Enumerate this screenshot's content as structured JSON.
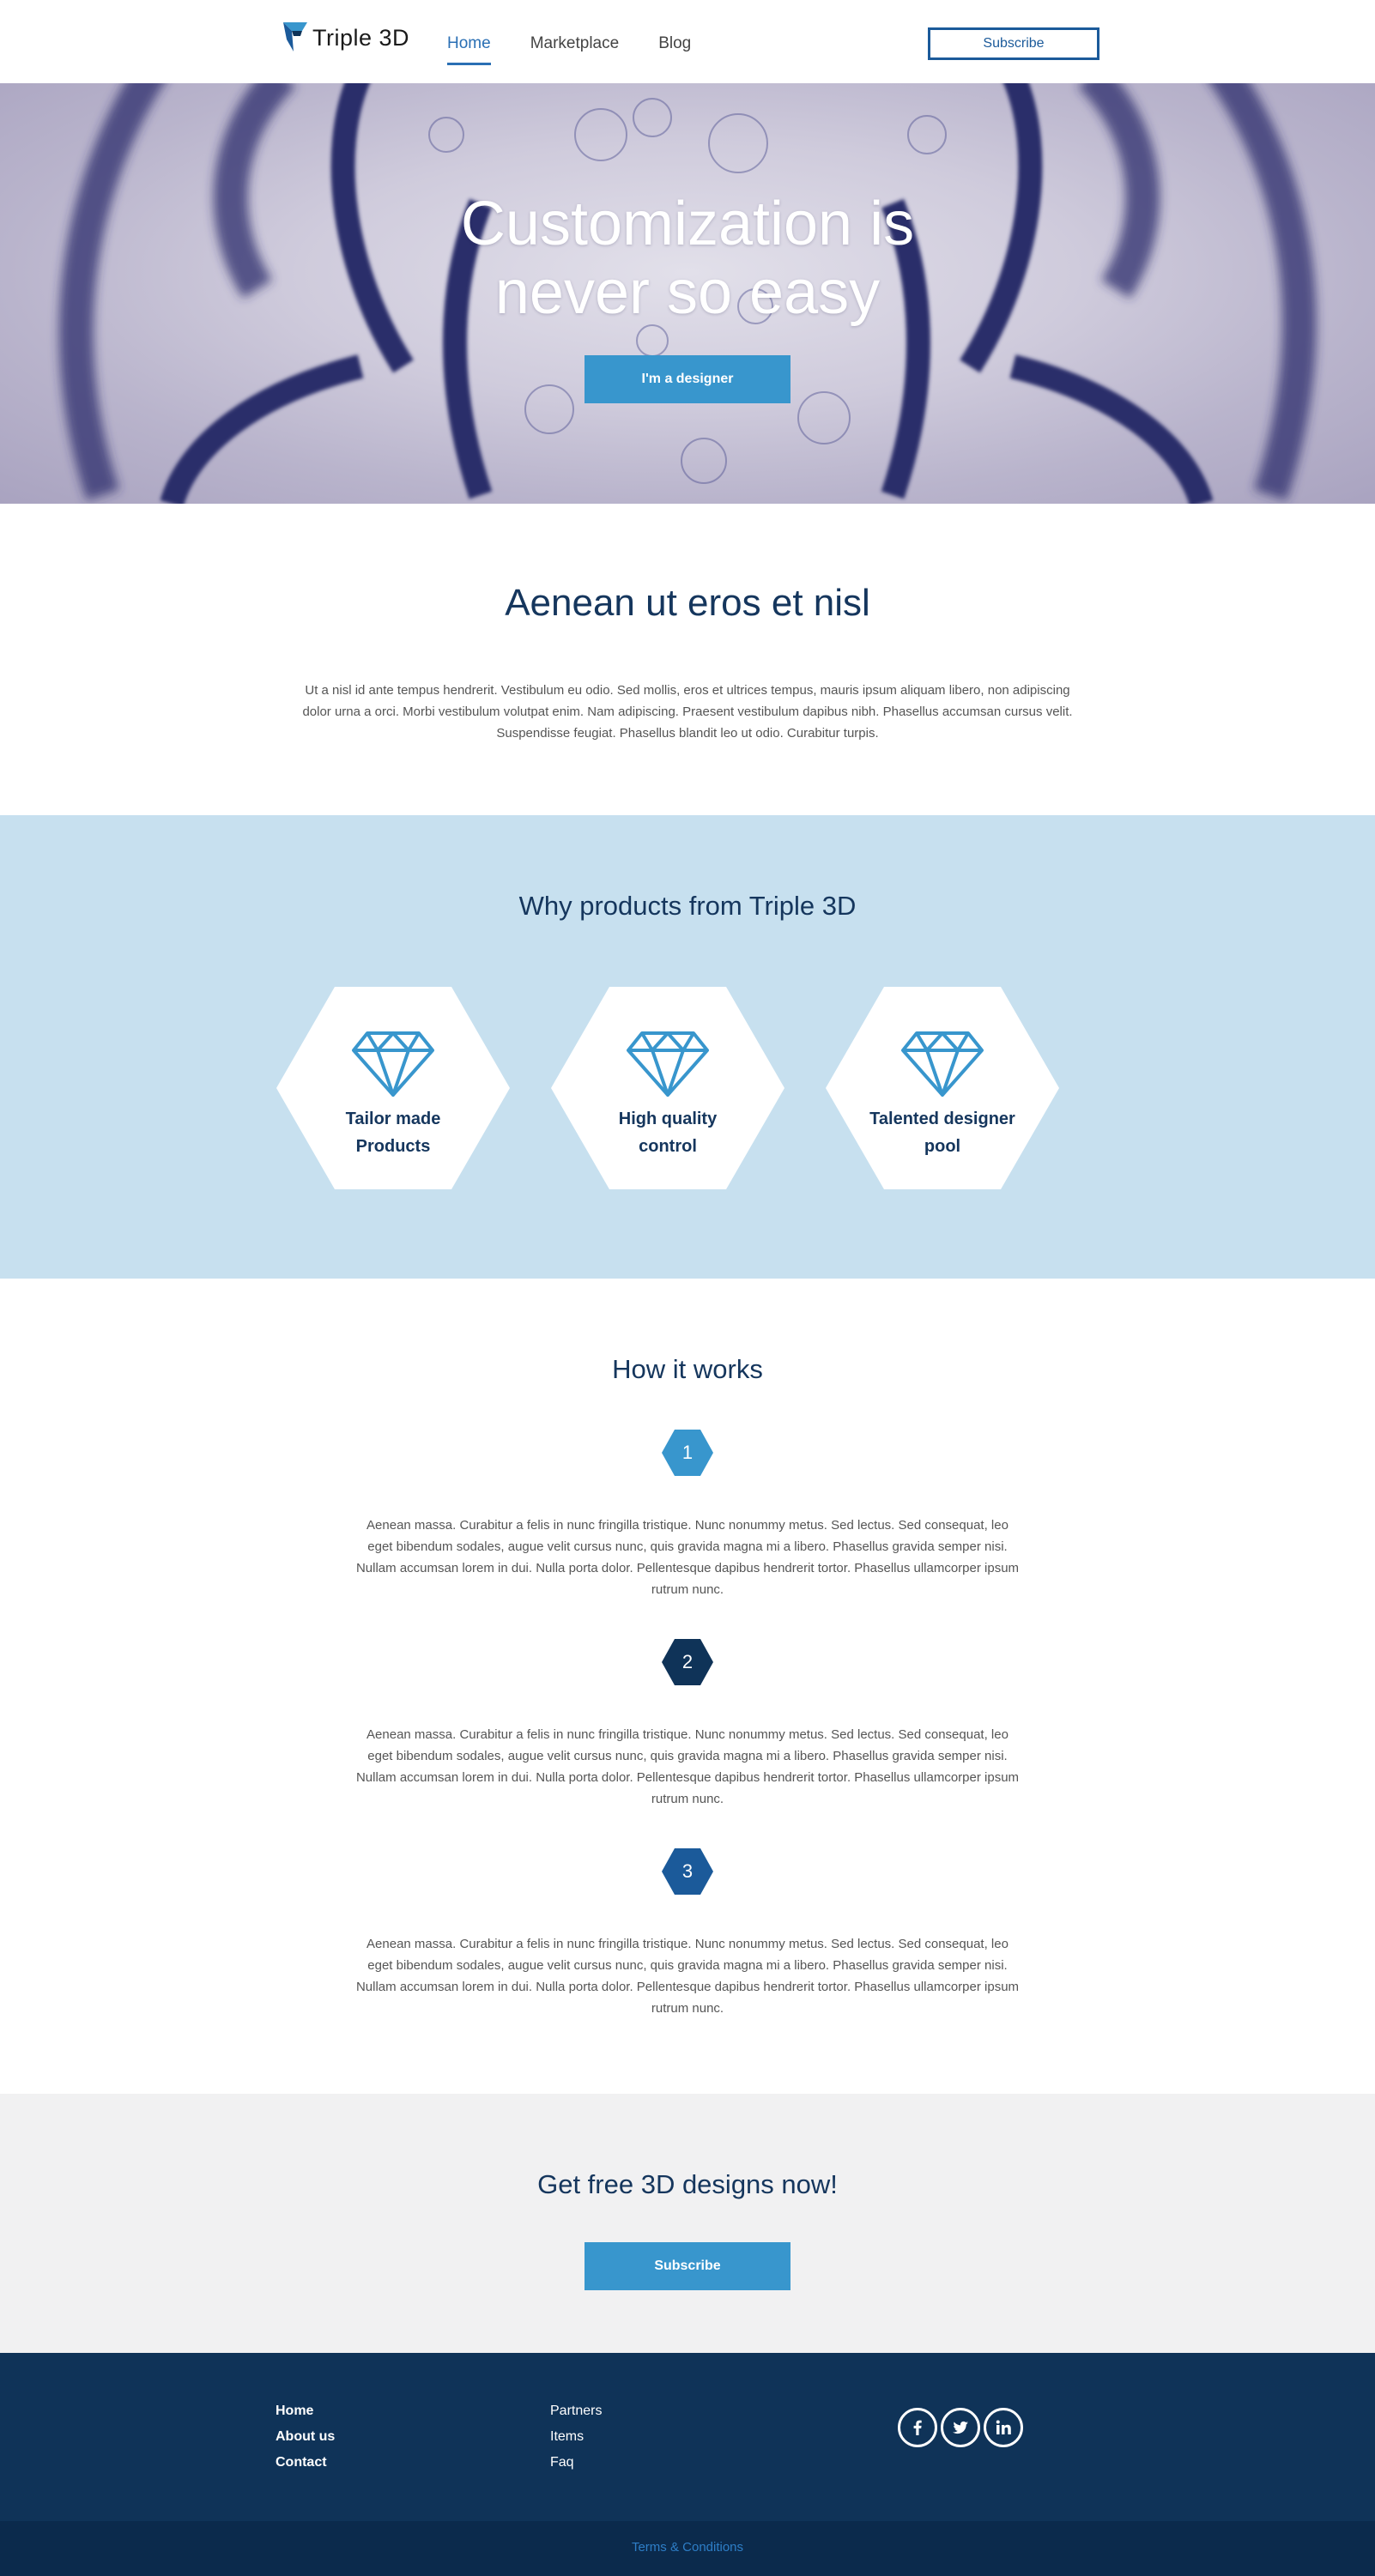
{
  "header": {
    "logo_text": "Triple 3D",
    "nav": [
      "Home",
      "Marketplace",
      "Blog"
    ],
    "active_nav": "Home",
    "subscribe_label": "Subscribe"
  },
  "hero": {
    "title_line1": "Customization is",
    "title_line2": "never so easy",
    "button_label": "I'm a designer"
  },
  "intro": {
    "title": "Aenean ut eros et nisl",
    "text": "Ut a nisl id ante tempus hendrerit. Vestibulum eu odio. Sed mollis, eros et ultrices tempus, mauris ipsum aliquam libero, non adipiscing dolor urna a orci. Morbi vestibulum volutpat enim. Nam adipiscing. Praesent vestibulum dapibus nibh. Phasellus accumsan cursus velit. Suspendisse feugiat. Phasellus blandit leo ut odio. Curabitur turpis."
  },
  "why": {
    "title": "Why products from Triple 3D",
    "cards": [
      {
        "line1": "Tailor made",
        "line2": "Products",
        "icon": "diamond-icon"
      },
      {
        "line1": "High quality",
        "line2": "control",
        "icon": "diamond-icon"
      },
      {
        "line1": "Talented designer",
        "line2": "pool",
        "icon": "diamond-icon"
      }
    ]
  },
  "how": {
    "title": "How it works",
    "steps": [
      {
        "number": "1",
        "color": "#3896cd",
        "text": "Aenean massa. Curabitur a felis in nunc fringilla tristique. Nunc nonummy metus. Sed lectus. Sed consequat, leo eget bibendum sodales, augue velit cursus nunc, quis gravida magna mi a libero. Phasellus gravida semper nisi. Nullam accumsan lorem in dui. Nulla porta dolor. Pellentesque dapibus hendrerit tortor. Phasellus ullamcorper ipsum rutrum nunc."
      },
      {
        "number": "2",
        "color": "#0f3358",
        "text": "Aenean massa. Curabitur a felis in nunc fringilla tristique. Nunc nonummy metus. Sed lectus. Sed consequat, leo eget bibendum sodales, augue velit cursus nunc, quis gravida magna mi a libero. Phasellus gravida semper nisi. Nullam accumsan lorem in dui. Nulla porta dolor. Pellentesque dapibus hendrerit tortor. Phasellus ullamcorper ipsum rutrum nunc."
      },
      {
        "number": "3",
        "color": "#1b5a9a",
        "text": "Aenean massa. Curabitur a felis in nunc fringilla tristique. Nunc nonummy metus. Sed lectus. Sed consequat, leo eget bibendum sodales, augue velit cursus nunc, quis gravida magna mi a libero. Phasellus gravida semper nisi. Nullam accumsan lorem in dui. Nulla porta dolor. Pellentesque dapibus hendrerit tortor. Phasellus ullamcorper ipsum rutrum nunc."
      }
    ]
  },
  "cta": {
    "title": "Get free 3D designs now!",
    "button_label": "Subscribe"
  },
  "footer": {
    "col1": [
      "Home",
      "About us",
      "Contact"
    ],
    "col2": [
      "Partners",
      "Items",
      "Faq"
    ],
    "socials": [
      "facebook-icon",
      "twitter-icon",
      "linkedin-icon"
    ],
    "terms": "Terms & Conditions"
  },
  "colors": {
    "accent": "#3896cd",
    "navy": "#15365d",
    "footer": "#0f3358",
    "light_blue_bg": "#c7e0ef"
  }
}
